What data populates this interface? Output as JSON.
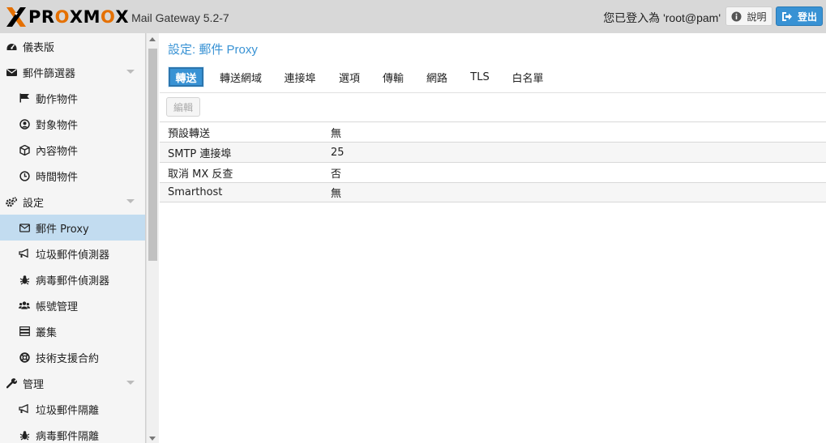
{
  "header": {
    "logo_parts": [
      "",
      "PRO",
      "",
      "MO",
      ""
    ],
    "logo_word": "PROXMOX",
    "version": "Mail Gateway 5.2-7",
    "login_info": "您已登入為 'root@pam'",
    "help_label": "說明",
    "logout_label": "登出",
    "accent_color": "#3892d4",
    "logo_orange": "#e57000"
  },
  "sidebar": {
    "items": [
      {
        "label": "儀表版",
        "icon": "dashboard-icon",
        "level": 0,
        "expandable": false
      },
      {
        "label": "郵件篩選器",
        "icon": "envelope-icon",
        "level": 0,
        "expandable": true
      },
      {
        "label": "動作物件",
        "icon": "flag-icon",
        "level": 1,
        "expandable": false
      },
      {
        "label": "對象物件",
        "icon": "user-circle-icon",
        "level": 1,
        "expandable": false
      },
      {
        "label": "內容物件",
        "icon": "cube-icon",
        "level": 1,
        "expandable": false
      },
      {
        "label": "時間物件",
        "icon": "clock-icon",
        "level": 1,
        "expandable": false
      },
      {
        "label": "設定",
        "icon": "gears-icon",
        "level": 0,
        "expandable": true
      },
      {
        "label": "郵件 Proxy",
        "icon": "envelope-outline-icon",
        "level": 1,
        "expandable": false,
        "selected": true
      },
      {
        "label": "垃圾郵件偵測器",
        "icon": "bullhorn-icon",
        "level": 1,
        "expandable": false
      },
      {
        "label": "病毒郵件偵測器",
        "icon": "bug-icon",
        "level": 1,
        "expandable": false
      },
      {
        "label": "帳號管理",
        "icon": "users-icon",
        "level": 1,
        "expandable": false
      },
      {
        "label": "叢集",
        "icon": "server-icon",
        "level": 1,
        "expandable": false
      },
      {
        "label": "技術支援合約",
        "icon": "life-ring-icon",
        "level": 1,
        "expandable": false
      },
      {
        "label": "管理",
        "icon": "wrench-icon",
        "level": 0,
        "expandable": true
      },
      {
        "label": "垃圾郵件隔離",
        "icon": "bullhorn-icon",
        "level": 1,
        "expandable": false
      },
      {
        "label": "病毒郵件隔離",
        "icon": "bug-icon",
        "level": 1,
        "expandable": false
      }
    ]
  },
  "main": {
    "title": "設定: 郵件 Proxy",
    "tabs": [
      {
        "label": "轉送",
        "active": true
      },
      {
        "label": "轉送網域"
      },
      {
        "label": "連接埠"
      },
      {
        "label": "選項"
      },
      {
        "label": "傳輸"
      },
      {
        "label": "網路"
      },
      {
        "label": "TLS"
      },
      {
        "label": "白名單"
      }
    ],
    "edit_label": "編輯",
    "rows": [
      {
        "name": "預設轉送",
        "value": "無"
      },
      {
        "name": "SMTP 連接埠",
        "value": "25"
      },
      {
        "name": "取消 MX 反查",
        "value": "否"
      },
      {
        "name": "Smarthost",
        "value": "無"
      }
    ]
  }
}
